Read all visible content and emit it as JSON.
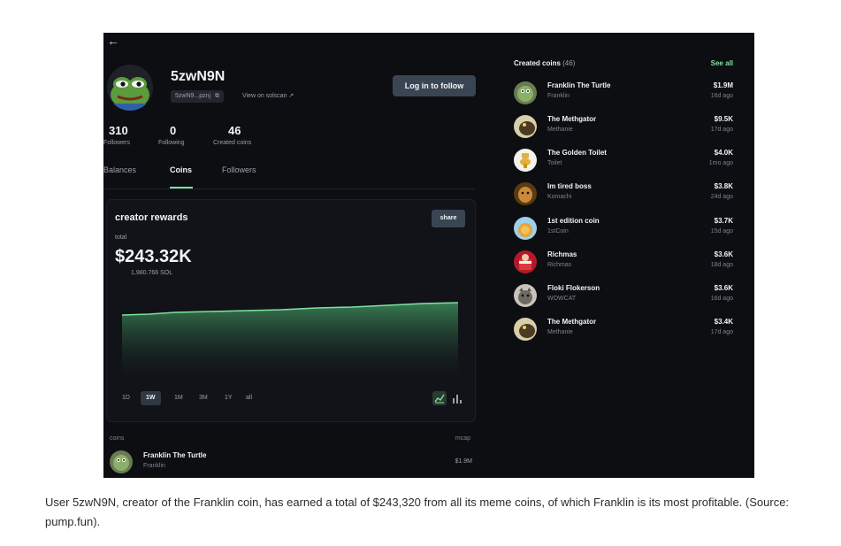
{
  "profile": {
    "back": "←",
    "username": "5zwN9N",
    "address_short": "5zwN9...pznj",
    "copy_icon": "⧉",
    "view_solscan": "View on solscan ↗",
    "login_button": "Log in to follow",
    "stats": [
      {
        "value": "310",
        "label": "Followers"
      },
      {
        "value": "0",
        "label": "Following"
      },
      {
        "value": "46",
        "label": "Created coins"
      }
    ],
    "tabs": [
      "Balances",
      "Coins",
      "Followers"
    ],
    "active_tab": "Coins"
  },
  "rewards": {
    "title": "creator rewards",
    "share": "share",
    "total_label": "total",
    "total_value": "$243.32K",
    "sol_value": "1,980.766 SOL",
    "ranges": [
      "1D",
      "1W",
      "1M",
      "3M",
      "1Y",
      "all"
    ],
    "active_range": "1W",
    "line_color": "#7ee2a0"
  },
  "coins_list": {
    "col_coins": "coins",
    "col_mcap": "mcap",
    "rows": [
      {
        "name": "Franklin The Turtle",
        "ticker": "Franklin",
        "mcap": "$1.9M"
      }
    ]
  },
  "created": {
    "title": "Created coins",
    "count": "(46)",
    "see_all": "See all",
    "items": [
      {
        "name": "Franklin The Turtle",
        "ticker": "Franklin",
        "mcap": "$1.9M",
        "age": "16d ago",
        "icon": "turtle-icon"
      },
      {
        "name": "The Methgator",
        "ticker": "Methanie",
        "mcap": "$9.5K",
        "age": "17d ago",
        "icon": "gator-icon"
      },
      {
        "name": "The Golden Toilet",
        "ticker": "Toilet",
        "mcap": "$4.0K",
        "age": "1mo ago",
        "icon": "toilet-icon"
      },
      {
        "name": "Im tired boss",
        "ticker": "Komachi",
        "mcap": "$3.8K",
        "age": "24d ago",
        "icon": "dog-icon"
      },
      {
        "name": "1st edition coin",
        "ticker": "1stCoin",
        "mcap": "$3.7K",
        "age": "15d ago",
        "icon": "coin-icon"
      },
      {
        "name": "Richmas",
        "ticker": "Richmas",
        "mcap": "$3.6K",
        "age": "18d ago",
        "icon": "santa-icon"
      },
      {
        "name": "Floki Flokerson",
        "ticker": "WOWCAT",
        "mcap": "$3.6K",
        "age": "16d ago",
        "icon": "cat-icon"
      },
      {
        "name": "The Methgator",
        "ticker": "Methanie",
        "mcap": "$3.4K",
        "age": "17d ago",
        "icon": "gator-icon"
      }
    ]
  },
  "caption": "User 5zwN9N, creator of the Franklin coin, has earned a total of $243,320 from all its meme coins, of which Franklin is its most profitable. (Source: pump.fun)."
}
